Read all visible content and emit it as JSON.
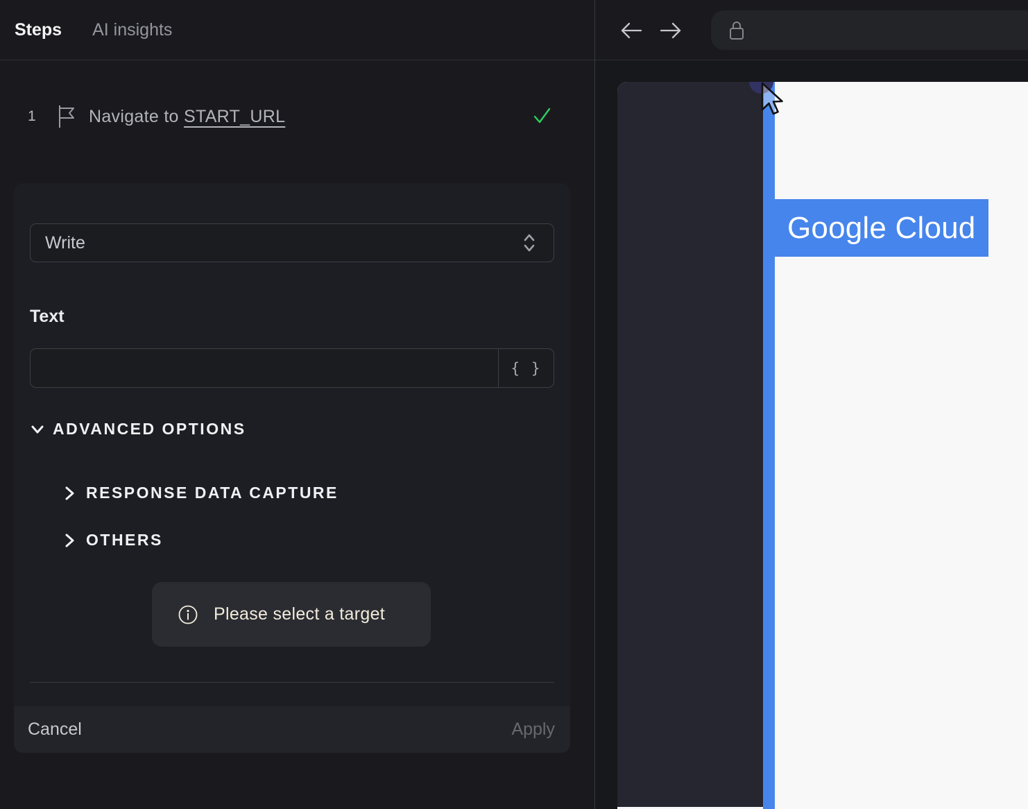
{
  "left_panel": {
    "tabs": [
      {
        "label": "Steps",
        "active": true
      },
      {
        "label": "AI insights",
        "active": false
      }
    ],
    "step": {
      "index": "1",
      "title_prefix": "Navigate to",
      "title_link": "START_URL",
      "status": "success"
    },
    "editor": {
      "action_select": {
        "value": "Write"
      },
      "text_field": {
        "label": "Text",
        "value": "",
        "placeholder": ""
      },
      "token_button_label": "{ }",
      "advanced_options_label": "ADVANCED OPTIONS",
      "subsections": [
        {
          "label": "RESPONSE DATA CAPTURE",
          "expanded": false
        },
        {
          "label": "OTHERS",
          "expanded": false
        }
      ],
      "notice_text": "Please select a target",
      "cancel_label": "Cancel",
      "apply_label": "Apply"
    }
  },
  "browser": {
    "url_value": "",
    "page": {
      "highlight_text": "Google Cloud"
    }
  },
  "colors": {
    "accent_blue": "#4685eb",
    "success_green": "#2fd05f",
    "notice_cream": "#f2ecdc",
    "panel_dark": "#1a1a1e",
    "card_dark": "#1d1e23",
    "page_sidebar": "#25262f",
    "click_dot_indigo": "#323363"
  }
}
